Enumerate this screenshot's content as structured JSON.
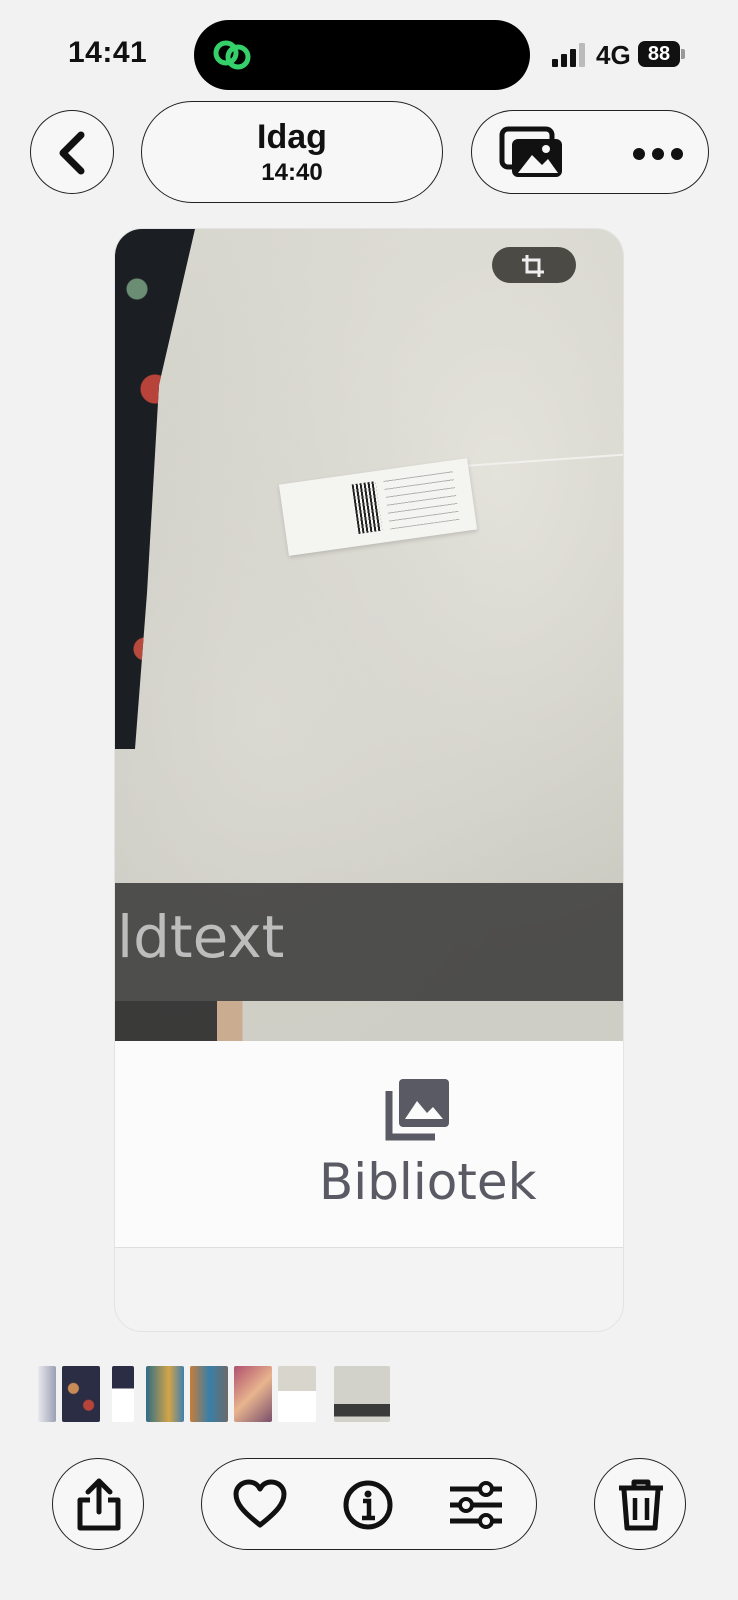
{
  "status_bar": {
    "time": "14:41",
    "network": "4G",
    "battery": "88"
  },
  "header": {
    "back_icon": "chevron-left-icon",
    "title": "Idag",
    "subtitle": "14:40",
    "gallery_icon": "photo-stack-icon",
    "more_icon": "ellipsis-icon"
  },
  "photo": {
    "crop_icon": "crop-icon",
    "overlay_text": "ldtext",
    "library_label": "Bibliotek",
    "library_icon": "photo-library-icon"
  },
  "thumbnails": {
    "count": 8,
    "selected_index": 7
  },
  "toolbar": {
    "share_icon": "share-icon",
    "favorite_icon": "heart-icon",
    "info_icon": "info-icon",
    "adjust_icon": "sliders-icon",
    "delete_icon": "trash-icon"
  }
}
